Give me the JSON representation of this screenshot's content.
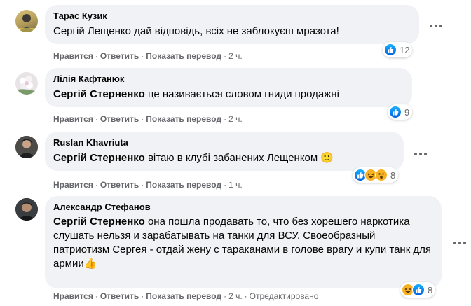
{
  "actions": {
    "like": "Нравится",
    "reply": "Ответить",
    "translate": "Показать перевод",
    "edited": "Отредактировано"
  },
  "comments": [
    {
      "author": "Тарас Кузик",
      "tag": "",
      "text": "Сергій Лещенко дай відповідь, всіх не заблокуєш мразота!",
      "time": "2 ч.",
      "reaction_count": "12"
    },
    {
      "author": "Лілія Кафтанюк",
      "tag": "Сергій Стерненко",
      "text": "це називається словом гниди продажні",
      "time": "2 ч.",
      "reaction_count": "9"
    },
    {
      "author": "Ruslan Khavriuta",
      "tag": "Сергій Стерненко",
      "text": "вітаю в клубі забанених Лещенком",
      "emoji": "🙂",
      "time": "1 ч.",
      "reaction_count": "8"
    },
    {
      "author": "Александр Стефанов",
      "tag": "Сергій Стерненко",
      "text": "она пошла продавать то, что без хорешего наркотика слушать нельзя и зарабатывать на танки для ВСУ. Своеобразный патриотизм Сергея - отдай жену с тараканами в голове врагу и купи танк для армии",
      "emoji": "👍",
      "time": "2 ч.",
      "reaction_count": "8"
    }
  ],
  "colors": {
    "bubble": "#f0f2f5",
    "meta_text": "#65676b",
    "like_blue": "#1877f2",
    "haha_yellow": "#f7b125"
  }
}
